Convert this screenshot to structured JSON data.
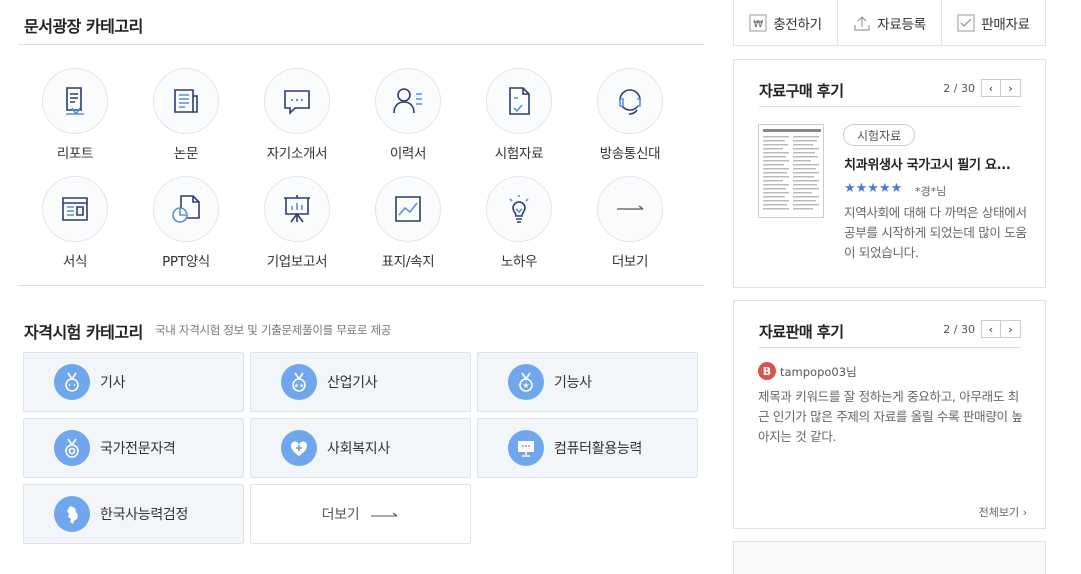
{
  "doc_category": {
    "title": "문서광장 카테고리",
    "items": [
      {
        "label": "리포트",
        "icon": "report-pen-icon"
      },
      {
        "label": "논문",
        "icon": "newspaper-icon"
      },
      {
        "label": "자기소개서",
        "icon": "speech-bubble-icon"
      },
      {
        "label": "이력서",
        "icon": "person-list-icon"
      },
      {
        "label": "시험자료",
        "icon": "exam-document-icon"
      },
      {
        "label": "방송통신대",
        "icon": "headset-icon"
      },
      {
        "label": "서식",
        "icon": "form-window-icon"
      },
      {
        "label": "PPT양식",
        "icon": "pie-document-icon"
      },
      {
        "label": "기업보고서",
        "icon": "presentation-board-icon"
      },
      {
        "label": "표지/속지",
        "icon": "image-frame-icon"
      },
      {
        "label": "노하우",
        "icon": "lightbulb-icon"
      },
      {
        "label": "더보기",
        "icon": "arrow-right-icon"
      }
    ]
  },
  "cert_category": {
    "title": "자격시험 카테고리",
    "subtitle": "국내 자격시험 정보 및 기출문제풀이를 무료로 제공",
    "items": [
      {
        "label": "기사",
        "icon": "medal-icon"
      },
      {
        "label": "산업기사",
        "icon": "medal-stars-icon"
      },
      {
        "label": "기능사",
        "icon": "medal-star-icon"
      },
      {
        "label": "국가전문자격",
        "icon": "medal-ring-icon"
      },
      {
        "label": "사회복지사",
        "icon": "heart-plus-icon"
      },
      {
        "label": "컴퓨터활용능력",
        "icon": "monitor-icon"
      },
      {
        "label": "한국사능력검정",
        "icon": "korea-map-icon"
      }
    ],
    "more_label": "더보기"
  },
  "topbar": {
    "charge": "충전하기",
    "upload": "자료등록",
    "sell": "판매자료"
  },
  "purchase_review": {
    "title": "자료구매 후기",
    "page": "2 / 30",
    "tag": "시험자료",
    "doc_title": "치과위생사 국가고시 필기 요...",
    "stars": "★★★★★",
    "rating": 5,
    "author": "*경*님",
    "body": "지역사회에 대해 다 까먹은 상태에서 공부를 시작하게 되었는데 많이 도움이 되었습니다."
  },
  "sales_review": {
    "title": "자료판매 후기",
    "page": "2 / 30",
    "avatar_letter": "B",
    "username": "tampopo03님",
    "body": "제목과 키워드를 잘 정하는게 중요하고, 아무래도 최근 인기가 많은 주제의 자료를 올릴 수록 판매량이 높아지는 것 같다.",
    "view_all": "전체보기 ›"
  },
  "colors": {
    "accent_blue": "#6fa6ec",
    "star_blue": "#4d78d8",
    "avatar_red": "#d9534f",
    "icon_navy": "#2c3e6b"
  }
}
